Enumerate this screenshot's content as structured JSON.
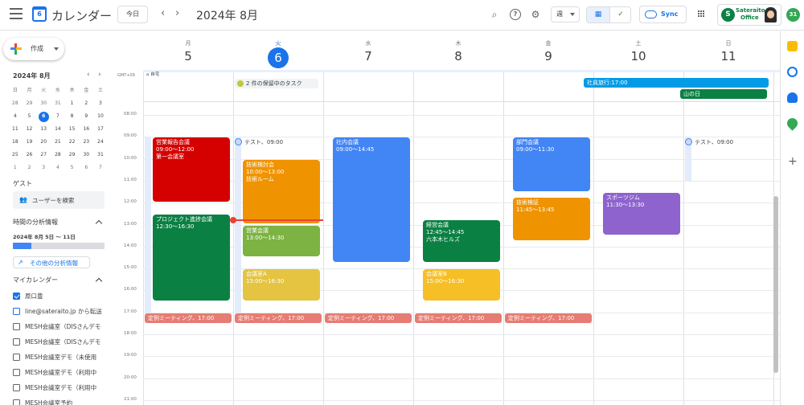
{
  "header": {
    "app_title": "カレンダー",
    "logo_day": "6",
    "today_label": "今日",
    "prev_icon": "‹",
    "next_icon": "›",
    "current_date": "2024年 8月",
    "view_label": "週",
    "sync_label": "Sync",
    "brand_line1": "Sateraito",
    "brand_line2": "Office",
    "account_badge": "31"
  },
  "sidebar": {
    "create_label": "作成",
    "mini_title": "2024年 8月",
    "mini_headers": [
      "日",
      "月",
      "火",
      "水",
      "木",
      "金",
      "土"
    ],
    "mini_weeks": [
      [
        "28",
        "29",
        "30",
        "31",
        "1",
        "2",
        "3"
      ],
      [
        "4",
        "5",
        "6",
        "7",
        "8",
        "9",
        "10"
      ],
      [
        "11",
        "12",
        "13",
        "14",
        "15",
        "16",
        "17"
      ],
      [
        "18",
        "19",
        "20",
        "21",
        "22",
        "23",
        "24"
      ],
      [
        "25",
        "26",
        "27",
        "28",
        "29",
        "30",
        "31"
      ],
      [
        "1",
        "2",
        "3",
        "4",
        "5",
        "6",
        "7"
      ]
    ],
    "guest_title": "ゲスト",
    "people_search": "ユーザーを検索",
    "insights_title": "時間の分析情報",
    "insights_range": "2024年 8月 5日 〜 11日",
    "insights_fill": 0.2,
    "more_insights": "その他の分析情報",
    "my_calendars_title": "マイカレンダー",
    "calendars": [
      {
        "label": "原口豊",
        "checked": true
      },
      {
        "label": "line@sateraito.jp から転送",
        "checked": false,
        "blue": true
      },
      {
        "label": "MESH会議室（DISさんデモ",
        "checked": false
      },
      {
        "label": "MESH会議室（DISさんデモ",
        "checked": false
      },
      {
        "label": "MESH会議室デモ（未使用",
        "checked": false
      },
      {
        "label": "MESH会議室デモ（利用中",
        "checked": false
      },
      {
        "label": "MESH会議室デモ（利用中",
        "checked": false
      },
      {
        "label": "MESH会議室予約",
        "checked": false
      }
    ]
  },
  "week": {
    "timezone": "GMT+09",
    "days": [
      {
        "dow": "月",
        "num": "5",
        "today": false
      },
      {
        "dow": "火",
        "num": "6",
        "today": true
      },
      {
        "dow": "水",
        "num": "7",
        "today": false
      },
      {
        "dow": "木",
        "num": "8",
        "today": false
      },
      {
        "dow": "金",
        "num": "9",
        "today": false
      },
      {
        "dow": "土",
        "num": "10",
        "today": false
      },
      {
        "dow": "日",
        "num": "11",
        "today": false
      }
    ],
    "hours": [
      "08:00",
      "09:00",
      "10:00",
      "11:00",
      "12:00",
      "13:00",
      "14:00",
      "15:00",
      "16:00",
      "17:00",
      "18:00",
      "19:00",
      "20:00",
      "21:00"
    ],
    "home_label": "自宅",
    "pending_tasks": "2 件の保留中のタスク",
    "allday_events": [
      {
        "title": "社員旅行:17:00",
        "color": "#039be5"
      },
      {
        "title": "山の日",
        "color": "#0b8043"
      }
    ],
    "events": [
      {
        "day": 0,
        "title": "営業報告会議",
        "time": "09:00〜12:00",
        "place": "第一会議室",
        "color": "#d50000"
      },
      {
        "day": 0,
        "title": "プロジェクト進捗会議",
        "time": "12:30〜16:30",
        "place": "",
        "color": "#0b8043"
      },
      {
        "day": 1,
        "title": "技術検討会",
        "time": "10:00〜13:00",
        "place": "技術ルーム",
        "color": "#f09300"
      },
      {
        "day": 1,
        "title": "営業会議",
        "time": "13:00〜14:30",
        "place": "",
        "color": "#7cb342"
      },
      {
        "day": 1,
        "title": "会議室A",
        "time": "15:00〜16:30",
        "place": "",
        "color": "#e4c441"
      },
      {
        "day": 2,
        "title": "社内会議",
        "time": "09:00〜14:45",
        "place": "",
        "color": "#4285f4"
      },
      {
        "day": 3,
        "title": "経営会議",
        "time": "12:45〜14:45",
        "place": "六本木ヒルズ",
        "color": "#0b8043"
      },
      {
        "day": 3,
        "title": "会議室B",
        "time": "15:00〜16:30",
        "place": "",
        "color": "#f6bf26"
      },
      {
        "day": 4,
        "title": "部門会議",
        "time": "09:00〜11:30",
        "place": "",
        "color": "#4285f4"
      },
      {
        "day": 4,
        "title": "技術検証",
        "time": "11:45〜13:45",
        "place": "",
        "color": "#f09300"
      },
      {
        "day": 5,
        "title": "スポーツジム",
        "time": "11:30〜13:30",
        "place": "",
        "color": "#8e63ce"
      }
    ],
    "tasks": [
      {
        "day": 1,
        "label": "テスト、09:00"
      },
      {
        "day": 6,
        "label": "テスト、09:00"
      }
    ],
    "recurring": "定例ミーティング、17:00",
    "recurring_color": "#e67c73"
  }
}
